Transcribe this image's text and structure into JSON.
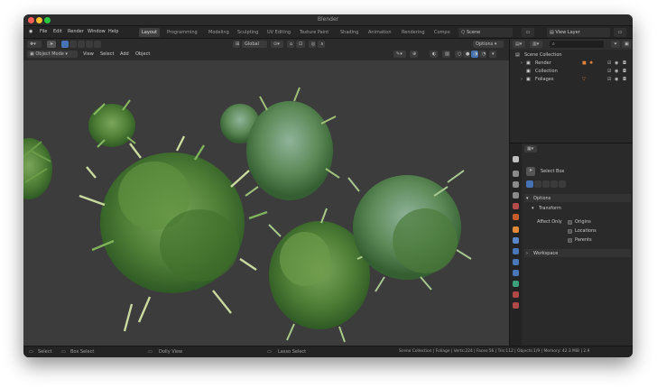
{
  "window": {
    "title": "Blender"
  },
  "menu": [
    "File",
    "Edit",
    "Render",
    "Window",
    "Help"
  ],
  "workspaces": [
    {
      "label": "Layout",
      "active": true
    },
    {
      "label": "Programming",
      "active": false
    },
    {
      "label": "Modeling",
      "active": false
    },
    {
      "label": "Sculpting",
      "active": false
    },
    {
      "label": "UV Editing",
      "active": false
    },
    {
      "label": "Texture Paint",
      "active": false
    },
    {
      "label": "Shading",
      "active": false
    },
    {
      "label": "Animation",
      "active": false
    },
    {
      "label": "Rendering",
      "active": false
    },
    {
      "label": "Compo",
      "active": false
    }
  ],
  "scene": {
    "label": "Scene",
    "view_layer": "View Layer"
  },
  "viewport_header": {
    "transform": "Global",
    "options": "Options",
    "mode": "Object Mode",
    "menus": [
      "View",
      "Select",
      "Add",
      "Object"
    ]
  },
  "outliner": {
    "root": "Scene Collection",
    "items": [
      "Render",
      "Collection",
      "Foliages"
    ]
  },
  "properties": {
    "tool_name": "Select Box",
    "options_label": "Options",
    "transform_label": "Transform",
    "affect_only": "Affect Only",
    "checkboxes": [
      "Origins",
      "Locations",
      "Parents"
    ],
    "workspace_label": "Workspace"
  },
  "statusbar": {
    "select": "Select",
    "box_select": "Box Select",
    "dolly": "Dolly View",
    "lasso": "Lasso Select",
    "info": "Scene Collection | Foliage | Verts:224 | Faces:56 | Tris:112 | Objects:1/9 | Memory: 42.3 MiB | 2.9"
  },
  "colors": {
    "accent": "#4772b3",
    "viewport_bg": "#3c3c3c",
    "foliage_dark": "#2f5a25",
    "foliage_light": "#7aa65a"
  }
}
